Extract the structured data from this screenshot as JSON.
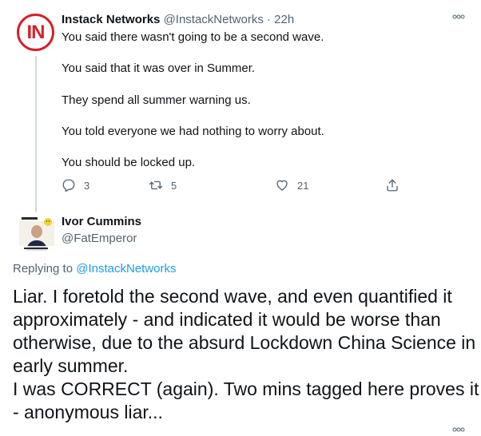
{
  "tweet1": {
    "avatar_text": "IN",
    "name": "Instack Networks",
    "handle": "@InstackNetworks",
    "separator": "·",
    "time": "22h",
    "lines": [
      "You said there wasn't going to be a second wave.",
      "You said that it was over in Summer.",
      "They spend all summer warning us.",
      "You told everyone we had nothing to worry about.",
      "You should be locked up."
    ],
    "actions": {
      "reply_count": "3",
      "retweet_count": "5",
      "like_count": "21"
    }
  },
  "tweet2": {
    "name": "Ivor Cummins",
    "handle": "@FatEmperor",
    "replying_prefix": "Replying to",
    "replying_to": "@InstackNetworks",
    "lines": [
      "Liar. I foretold the second wave, and even quantified it",
      "approximately - and indicated it would be worse than",
      "otherwise, due to the absurd Lockdown China Science in",
      "early summer.",
      "I was CORRECT (again). Two mins tagged here proves it",
      "- anonymous liar..."
    ]
  },
  "colors": {
    "brand_red": "#d4202a",
    "link_blue": "#1d9bf0",
    "muted": "#536471",
    "text": "#0f1419",
    "thread_line": "#cfd9de"
  },
  "icons": {
    "more": "more-options-icon",
    "reply": "reply-icon",
    "retweet": "retweet-icon",
    "like": "heart-icon",
    "share": "share-icon"
  }
}
